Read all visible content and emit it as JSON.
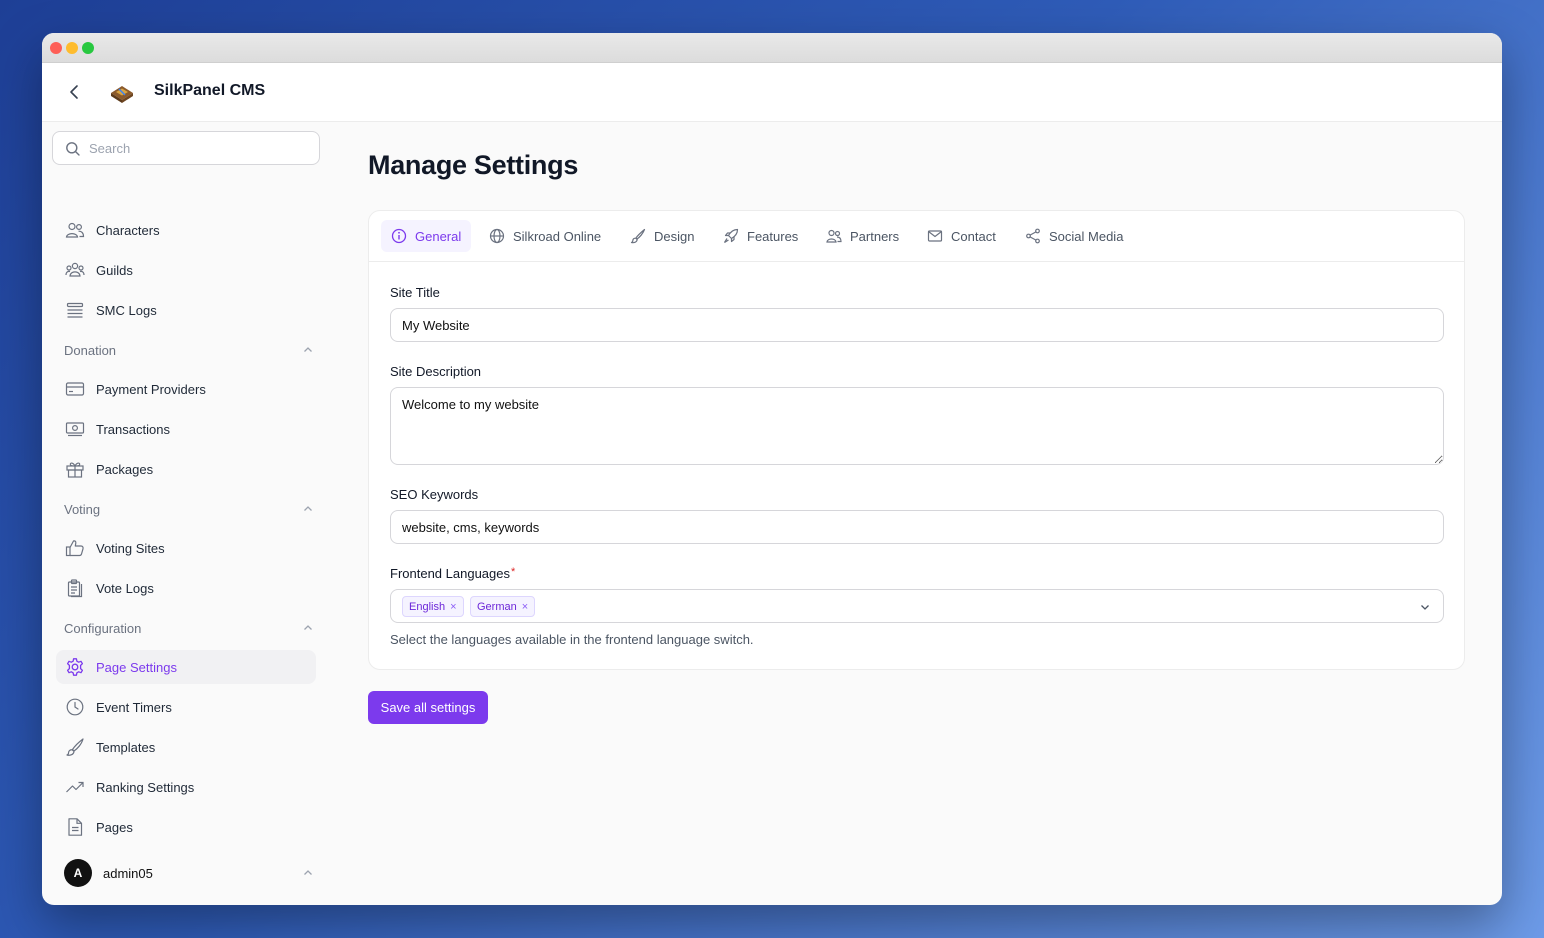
{
  "app": {
    "title": "SilkPanel CMS"
  },
  "search": {
    "placeholder": "Search"
  },
  "sidebar": {
    "items_top": [
      {
        "label": "Characters",
        "icon": "users-icon"
      },
      {
        "label": "Guilds",
        "icon": "group-icon"
      },
      {
        "label": "SMC Logs",
        "icon": "list-icon"
      }
    ],
    "groups": [
      {
        "title": "Donation",
        "items": [
          {
            "label": "Payment Providers",
            "icon": "credit-card-icon"
          },
          {
            "label": "Transactions",
            "icon": "banknote-icon"
          },
          {
            "label": "Packages",
            "icon": "gift-icon"
          }
        ]
      },
      {
        "title": "Voting",
        "items": [
          {
            "label": "Voting Sites",
            "icon": "thumbs-up-icon"
          },
          {
            "label": "Vote Logs",
            "icon": "clipboard-icon"
          }
        ]
      },
      {
        "title": "Configuration",
        "items": [
          {
            "label": "Page Settings",
            "icon": "gear-icon",
            "active": true
          },
          {
            "label": "Event Timers",
            "icon": "clock-icon"
          },
          {
            "label": "Templates",
            "icon": "brush-icon"
          },
          {
            "label": "Ranking Settings",
            "icon": "trending-up-icon"
          },
          {
            "label": "Pages",
            "icon": "document-icon"
          }
        ]
      }
    ]
  },
  "user": {
    "initial": "A",
    "name": "admin05"
  },
  "page": {
    "title": "Manage Settings"
  },
  "tabs": [
    {
      "label": "General",
      "icon": "info-icon",
      "active": true
    },
    {
      "label": "Silkroad Online",
      "icon": "globe-icon"
    },
    {
      "label": "Design",
      "icon": "brush-icon"
    },
    {
      "label": "Features",
      "icon": "rocket-icon"
    },
    {
      "label": "Partners",
      "icon": "users-icon"
    },
    {
      "label": "Contact",
      "icon": "envelope-icon"
    },
    {
      "label": "Social Media",
      "icon": "share-icon"
    }
  ],
  "form": {
    "site_title": {
      "label": "Site Title",
      "value": "My Website"
    },
    "site_description": {
      "label": "Site Description",
      "value": "Welcome to my website"
    },
    "seo_keywords": {
      "label": "SEO Keywords",
      "value": "website, cms, keywords"
    },
    "frontend_languages": {
      "label": "Frontend Languages",
      "required_mark": "*",
      "selected": [
        "English",
        "German"
      ],
      "remove_glyph": "×",
      "hint": "Select the languages available in the frontend language switch."
    }
  },
  "actions": {
    "save_label": "Save all settings"
  },
  "colors": {
    "accent": "#7c3aed",
    "accent_bg": "#f5f3ff",
    "active_nav_bg": "#f1f1f3"
  }
}
